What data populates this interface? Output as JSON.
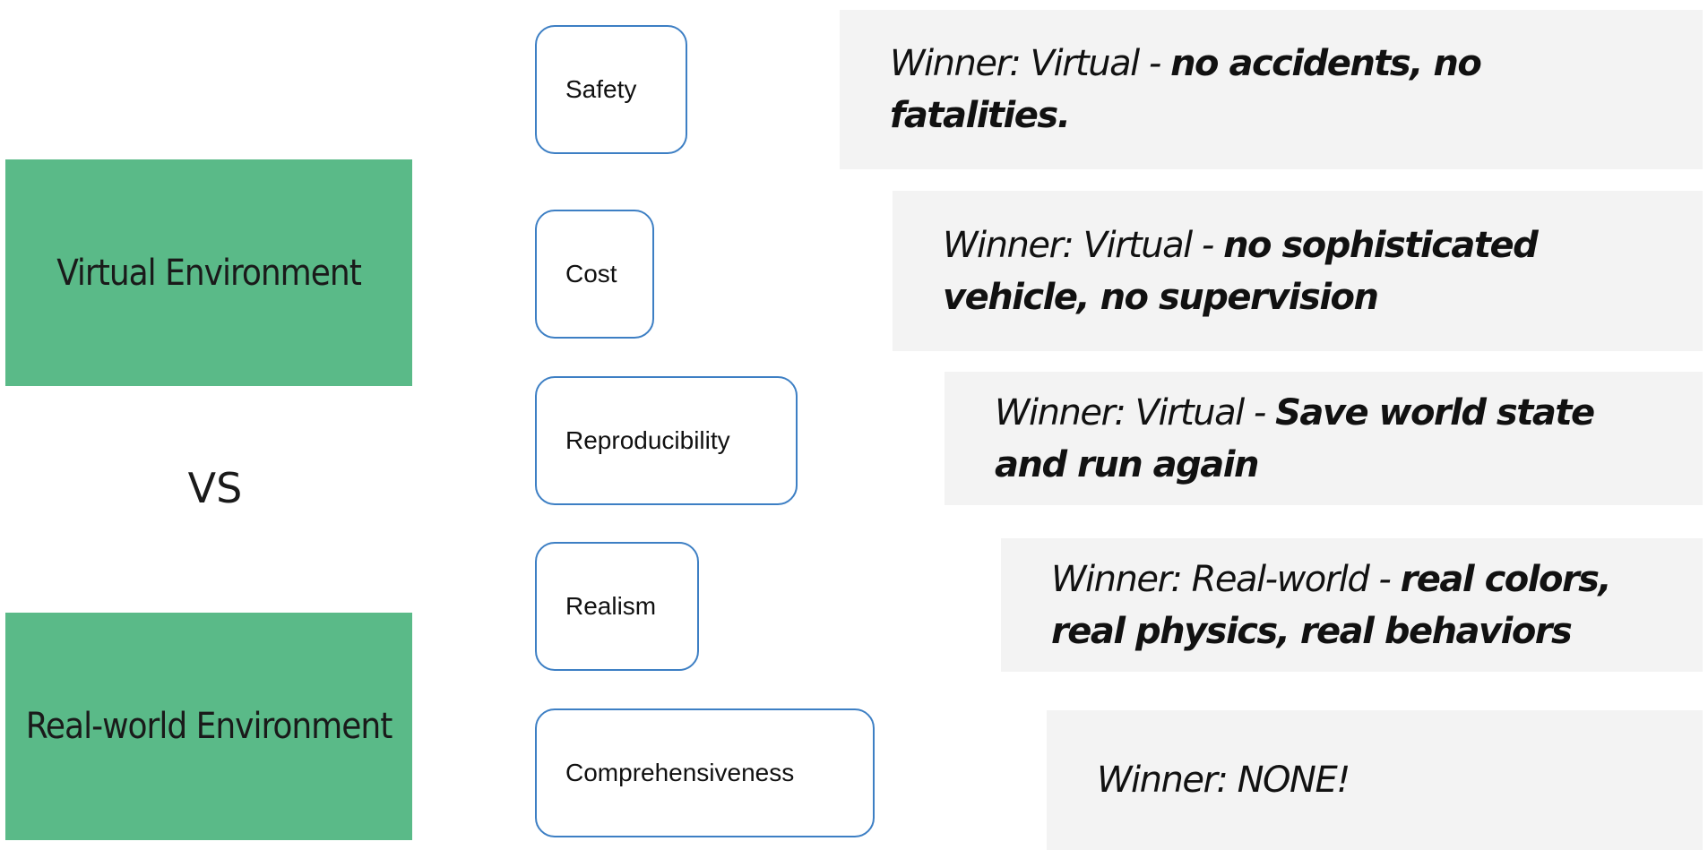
{
  "environments": {
    "virtual": "Virtual Environment",
    "vs": "VS",
    "real": "Real-world Environment"
  },
  "criteria": [
    {
      "label": "Safety",
      "winner_lead": "Winner: Virtual - ",
      "winner_detail": "no accidents, no fatalities."
    },
    {
      "label": "Cost",
      "winner_lead": "Winner: Virtual - ",
      "winner_detail": "no sophisticated vehicle, no supervision"
    },
    {
      "label": "Reproducibility",
      "winner_lead": "Winner: Virtual - ",
      "winner_detail": "Save world state and run again"
    },
    {
      "label": "Realism",
      "winner_lead": "Winner: Real-world - ",
      "winner_detail": "real colors, real physics, real behaviors"
    },
    {
      "label": "Comprehensiveness",
      "winner_lead": "Winner: NONE!",
      "winner_detail": ""
    }
  ],
  "colors": {
    "env_fill": "#5aba88",
    "criterion_border": "#3d7fc4",
    "winner_fill": "#f3f3f3"
  }
}
